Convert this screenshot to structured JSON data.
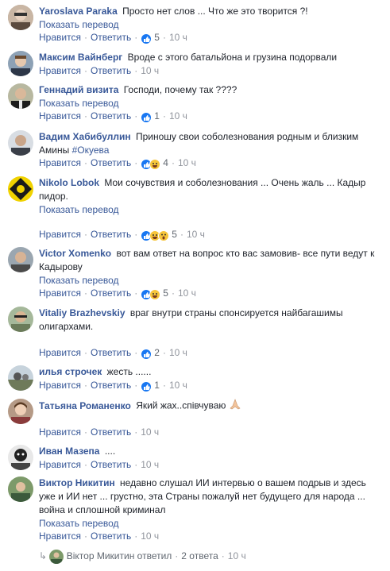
{
  "comments": [
    {
      "name": "Yaroslava Paraka",
      "text": "Просто нет слов ... Что же это творится ?!",
      "translate": "Показать перевод",
      "like": "Нравится",
      "reply": "Ответить",
      "reactions": "5",
      "time": "10 ч",
      "icons": [
        "like-reaction-icon"
      ]
    },
    {
      "name": "Максим Вайнберг",
      "text": "Вроде с этого батальйона и грузина подорвали",
      "like": "Нравится",
      "reply": "Ответить",
      "time": "10 ч"
    },
    {
      "name": "Геннадий визита",
      "text": "Господи, почему так ????",
      "translate": "Показать перевод",
      "like": "Нравится",
      "reply": "Ответить",
      "reactions": "1",
      "time": "10 ч",
      "icons": [
        "like-reaction-icon"
      ]
    },
    {
      "name": "Вадим Хабибуллин",
      "text": "Приношу свои соболезнования родным и близким Амины",
      "hashtag": "#Окуева",
      "like": "Нравится",
      "reply": "Ответить",
      "reactions": "4",
      "time": "10 ч",
      "icons": [
        "like-reaction-icon",
        "haha-reaction-icon"
      ]
    },
    {
      "name": "Nikolo Lobok",
      "text": "Мои сочувствия и соболезнования ... Очень жаль ... Кадыр пидор.",
      "translate": "Показать перевод",
      "like": "Нравится",
      "reply": "Ответить",
      "reactions": "5",
      "time": "10 ч",
      "icons": [
        "like-reaction-icon",
        "haha-reaction-icon",
        "wow-reaction-icon"
      ]
    },
    {
      "name": "Victor Xomenko",
      "text": "вот вам ответ на вопрос кто вас замовив- все пути ведут к Кадырову",
      "translate": "Показать перевод",
      "like": "Нравится",
      "reply": "Ответить",
      "reactions": "5",
      "time": "10 ч",
      "icons": [
        "like-reaction-icon",
        "haha-reaction-icon"
      ]
    },
    {
      "name": "Vitaliy Brazhevskiy",
      "text": "враг внутри страны спонсируется найбагашимы олигархами.",
      "like": "Нравится",
      "reply": "Ответить",
      "reactions": "2",
      "time": "10 ч",
      "icons": [
        "like-reaction-icon"
      ]
    },
    {
      "name": "илья строчек",
      "text": "жесть ......",
      "like": "Нравится",
      "reply": "Ответить",
      "reactions": "1",
      "time": "10 ч",
      "icons": [
        "like-reaction-icon"
      ]
    },
    {
      "name": "Татьяна Романенко",
      "text": "Який жах..співчуваю",
      "like": "Нравится",
      "reply": "Ответить",
      "time": "10 ч"
    },
    {
      "name": "Иван Мазепа",
      "text": "....",
      "like": "Нравится",
      "reply": "Ответить",
      "time": "10 ч"
    },
    {
      "name": "Виктор Никитин",
      "text": "недавно слушал ИИ интервью о вашем подрыв и здесь уже и ИИ нет ... грустно, эта Страны пожалуй нет будущего для народа ... война и сплошной криминал",
      "translate": "Показать перевод",
      "like": "Нравится",
      "reply": "Ответить",
      "time": "10 ч"
    }
  ],
  "reply_summary": {
    "author": "Віктор Микитин",
    "verb": "ответил",
    "count": "2 ответа",
    "time": "10 ч"
  },
  "colors": {
    "link": "#385898",
    "meta": "#606770",
    "like": "#1877f2",
    "emoji": "#f7c53b"
  }
}
